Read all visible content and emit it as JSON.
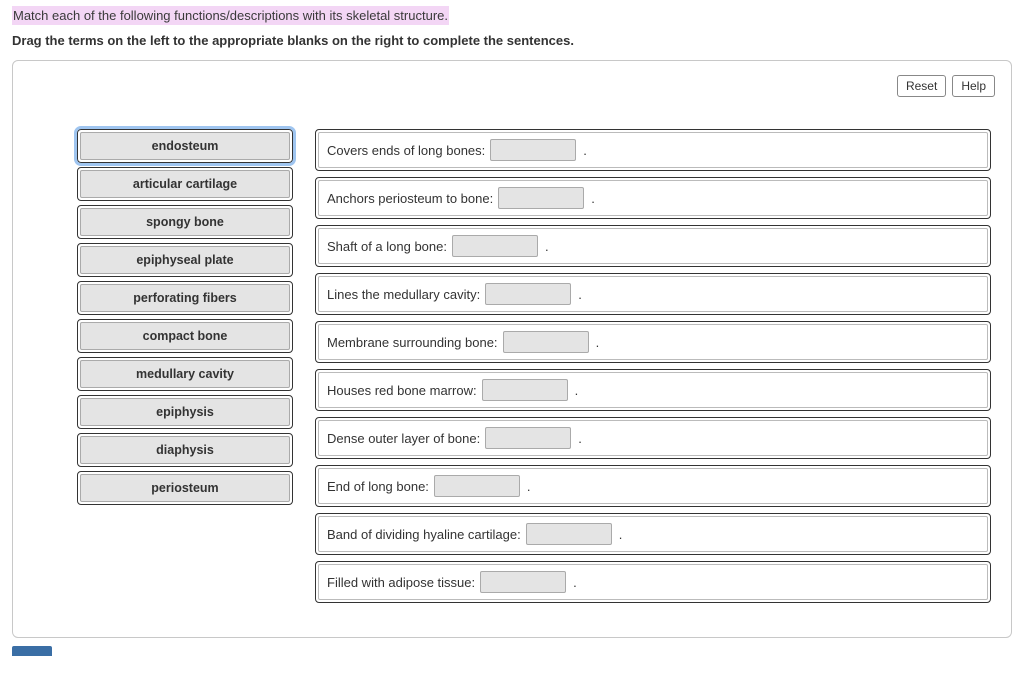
{
  "header": {
    "question": "Match each of the following functions/descriptions with its skeletal structure.",
    "instruction": "Drag the terms on the left to the appropriate blanks on the right to complete the sentences."
  },
  "toolbar": {
    "reset_label": "Reset",
    "help_label": "Help"
  },
  "terms": [
    {
      "label": "endosteum",
      "selected": true
    },
    {
      "label": "articular cartilage",
      "selected": false
    },
    {
      "label": "spongy bone",
      "selected": false
    },
    {
      "label": "epiphyseal plate",
      "selected": false
    },
    {
      "label": "perforating fibers",
      "selected": false
    },
    {
      "label": "compact bone",
      "selected": false
    },
    {
      "label": "medullary cavity",
      "selected": false
    },
    {
      "label": "epiphysis",
      "selected": false
    },
    {
      "label": "diaphysis",
      "selected": false
    },
    {
      "label": "periosteum",
      "selected": false
    }
  ],
  "sentences": [
    {
      "prefix": "Covers ends of long bones:",
      "suffix": "."
    },
    {
      "prefix": "Anchors periosteum to bone:",
      "suffix": "."
    },
    {
      "prefix": "Shaft of a long bone:",
      "suffix": "."
    },
    {
      "prefix": "Lines the medullary cavity:",
      "suffix": "."
    },
    {
      "prefix": "Membrane surrounding bone:",
      "suffix": "."
    },
    {
      "prefix": "Houses red bone marrow:",
      "suffix": "."
    },
    {
      "prefix": "Dense outer layer of bone:",
      "suffix": "."
    },
    {
      "prefix": "End of long bone:",
      "suffix": "."
    },
    {
      "prefix": "Band of dividing hyaline cartilage:",
      "suffix": "."
    },
    {
      "prefix": "Filled with adipose tissue:",
      "suffix": "."
    }
  ]
}
